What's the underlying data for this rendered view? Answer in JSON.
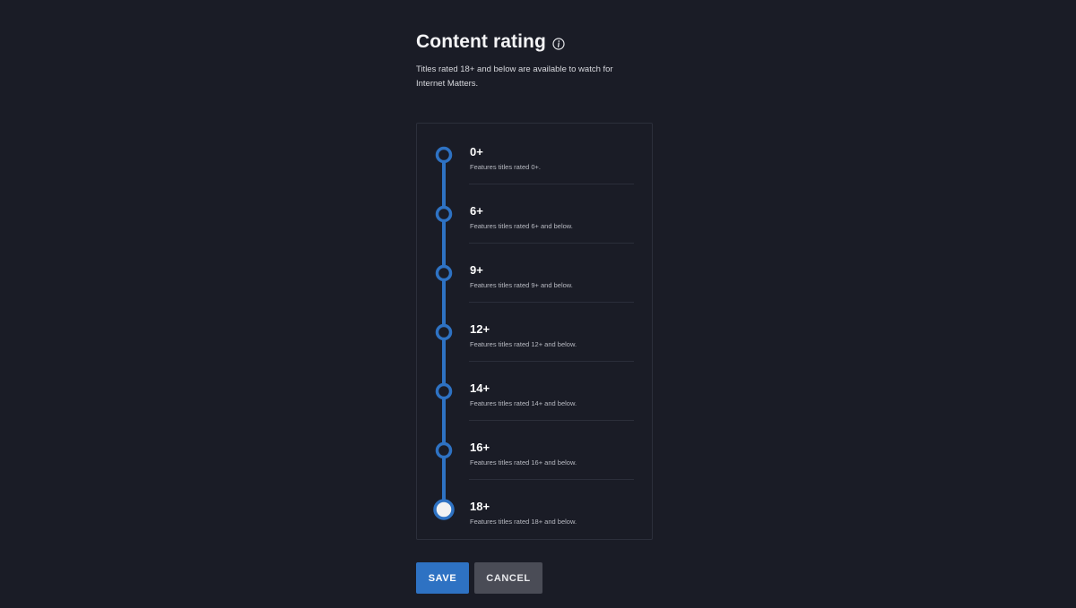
{
  "header": {
    "title": "Content rating",
    "subtitle": "Titles rated 18+ and below are available to watch for Internet Matters."
  },
  "icons": {
    "info": "info-icon"
  },
  "colors": {
    "background": "#1a1c26",
    "accent": "#2e72c3",
    "track": "#2e72c3",
    "selected_fill": "#f2f2f2",
    "cancel_button": "#4a4c56"
  },
  "ratings": {
    "selected_index": 6,
    "items": [
      {
        "label": "0+",
        "description": "Features titles rated 0+."
      },
      {
        "label": "6+",
        "description": "Features titles rated 6+ and below."
      },
      {
        "label": "9+",
        "description": "Features titles rated 9+ and below."
      },
      {
        "label": "12+",
        "description": "Features titles rated 12+ and below."
      },
      {
        "label": "14+",
        "description": "Features titles rated 14+ and below."
      },
      {
        "label": "16+",
        "description": "Features titles rated 16+ and below."
      },
      {
        "label": "18+",
        "description": "Features titles rated 18+ and below."
      }
    ]
  },
  "actions": {
    "save_label": "SAVE",
    "cancel_label": "CANCEL"
  }
}
